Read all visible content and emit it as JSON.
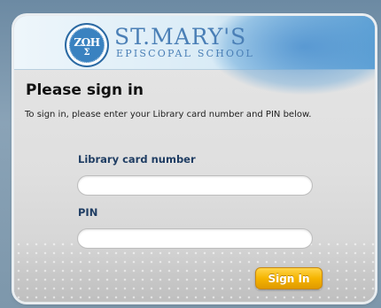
{
  "school": {
    "name": "ST.MARY'S",
    "subtitle": "EPISCOPAL SCHOOL",
    "seal_letters": "ZΩH",
    "seal_letter_bottom": "Σ",
    "seal_icon": "school-seal-icon"
  },
  "login": {
    "heading": "Please sign in",
    "instructions": "To sign in, please enter your Library card number and PIN below.",
    "card_label": "Library card number",
    "card_value": "",
    "pin_label": "PIN",
    "pin_value": "",
    "submit_label": "Sign In"
  },
  "colors": {
    "accent": "#4a7fb6",
    "button": "#f5b400",
    "label": "#1f3d63"
  }
}
